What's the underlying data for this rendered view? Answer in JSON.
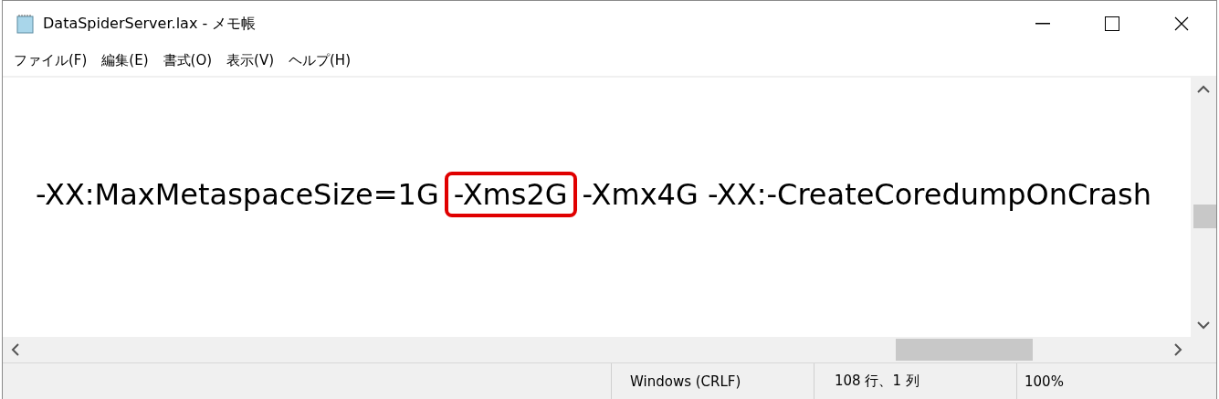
{
  "window": {
    "title": "DataSpiderServer.lax - メモ帳"
  },
  "menu": [
    {
      "label": "ファイル(F)"
    },
    {
      "label": "編集(E)"
    },
    {
      "label": "書式(O)"
    },
    {
      "label": "表示(V)"
    },
    {
      "label": "ヘルプ(H)"
    }
  ],
  "editor": {
    "segments": [
      {
        "text": "-XX:MaxMetaspaceSize=1G",
        "highlighted": false
      },
      {
        "text": "-Xms2G",
        "highlighted": true
      },
      {
        "text": "-Xmx4G -XX:-CreateCoredumpOnCrash",
        "highlighted": false
      }
    ]
  },
  "status_bar": [
    "Windows (CRLF)",
    "108 行、1 列",
    "100%"
  ]
}
